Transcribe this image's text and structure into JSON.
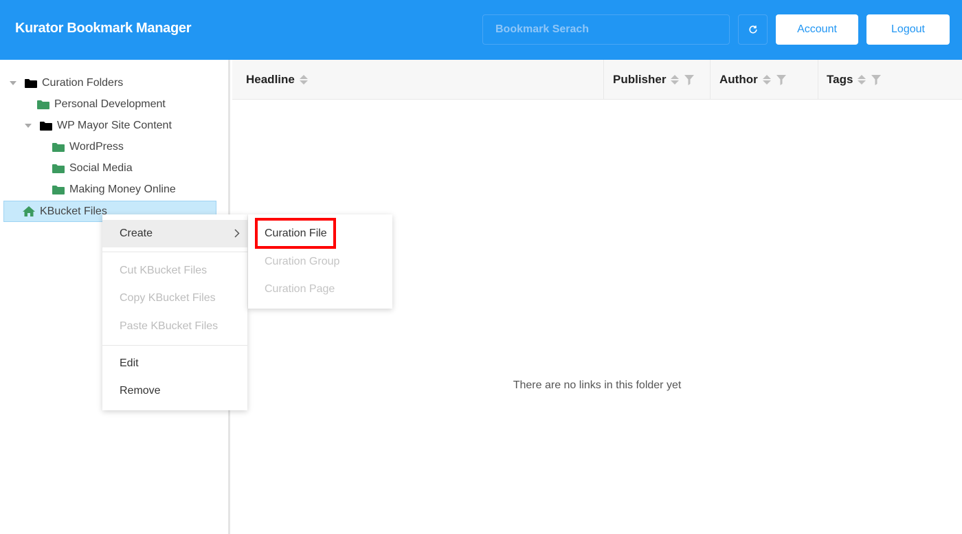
{
  "header": {
    "title": "Kurator Bookmark Manager",
    "search_placeholder": "Bookmark Serach",
    "refresh_icon": "refresh-icon",
    "account_label": "Account",
    "logout_label": "Logout",
    "bg_color": "#2196f3"
  },
  "sidebar": {
    "items": [
      {
        "label": "Curation Folders",
        "icon": "folder-icon",
        "color": "#000000"
      },
      {
        "label": "Personal Development",
        "icon": "folder-icon",
        "color": "#3c9a5f"
      },
      {
        "label": "WP Mayor Site Content",
        "icon": "folder-icon",
        "color": "#000000"
      },
      {
        "label": "WordPress",
        "icon": "folder-icon",
        "color": "#3c9a5f"
      },
      {
        "label": "Social Media",
        "icon": "folder-icon",
        "color": "#3c9a5f"
      },
      {
        "label": "Making Money Online",
        "icon": "folder-icon",
        "color": "#3c9a5f"
      },
      {
        "label": "KBucket Files",
        "icon": "home-icon",
        "color": "#3c9a5f"
      }
    ]
  },
  "table": {
    "columns": [
      {
        "label": "Headline",
        "sortable": true,
        "filterable": false
      },
      {
        "label": "Publisher",
        "sortable": true,
        "filterable": true
      },
      {
        "label": "Author",
        "sortable": true,
        "filterable": true
      },
      {
        "label": "Tags",
        "sortable": true,
        "filterable": true
      }
    ],
    "empty_text": "There are no links in this folder yet"
  },
  "context_menu": {
    "create_label": "Create",
    "cut_label": "Cut KBucket Files",
    "copy_label": "Copy KBucket Files",
    "paste_label": "Paste KBucket Files",
    "edit_label": "Edit",
    "remove_label": "Remove"
  },
  "submenu": {
    "items": [
      {
        "label": "Curation File",
        "enabled": true
      },
      {
        "label": "Curation Group",
        "enabled": false
      },
      {
        "label": "Curation Page",
        "enabled": false
      }
    ],
    "highlight_color": "#ff0000"
  }
}
